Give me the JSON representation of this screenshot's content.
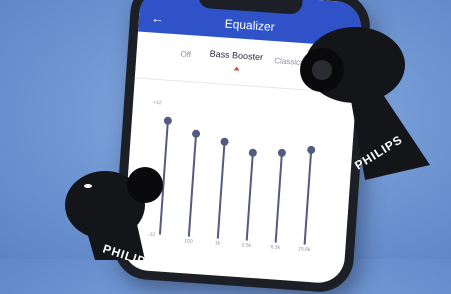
{
  "app": {
    "title": "Equalizer"
  },
  "presets": {
    "off": "Off",
    "active": "Bass Booster",
    "next": "Classical"
  },
  "eq": {
    "scale_top": "+12",
    "scale_bottom": "-12",
    "bands": [
      {
        "label": "",
        "level": 0.95
      },
      {
        "label": "100",
        "level": 0.86
      },
      {
        "label": "1k",
        "level": 0.81
      },
      {
        "label": "2.5k",
        "level": 0.73
      },
      {
        "label": "6.3k",
        "level": 0.75
      },
      {
        "label": "15.6k",
        "level": 0.79
      }
    ]
  },
  "brand": {
    "logo": "PHILIPS"
  },
  "colors": {
    "appbar": "#2f52c8",
    "slider": "#545a80",
    "caret": "#e0443a",
    "background": "#6f96d2"
  }
}
